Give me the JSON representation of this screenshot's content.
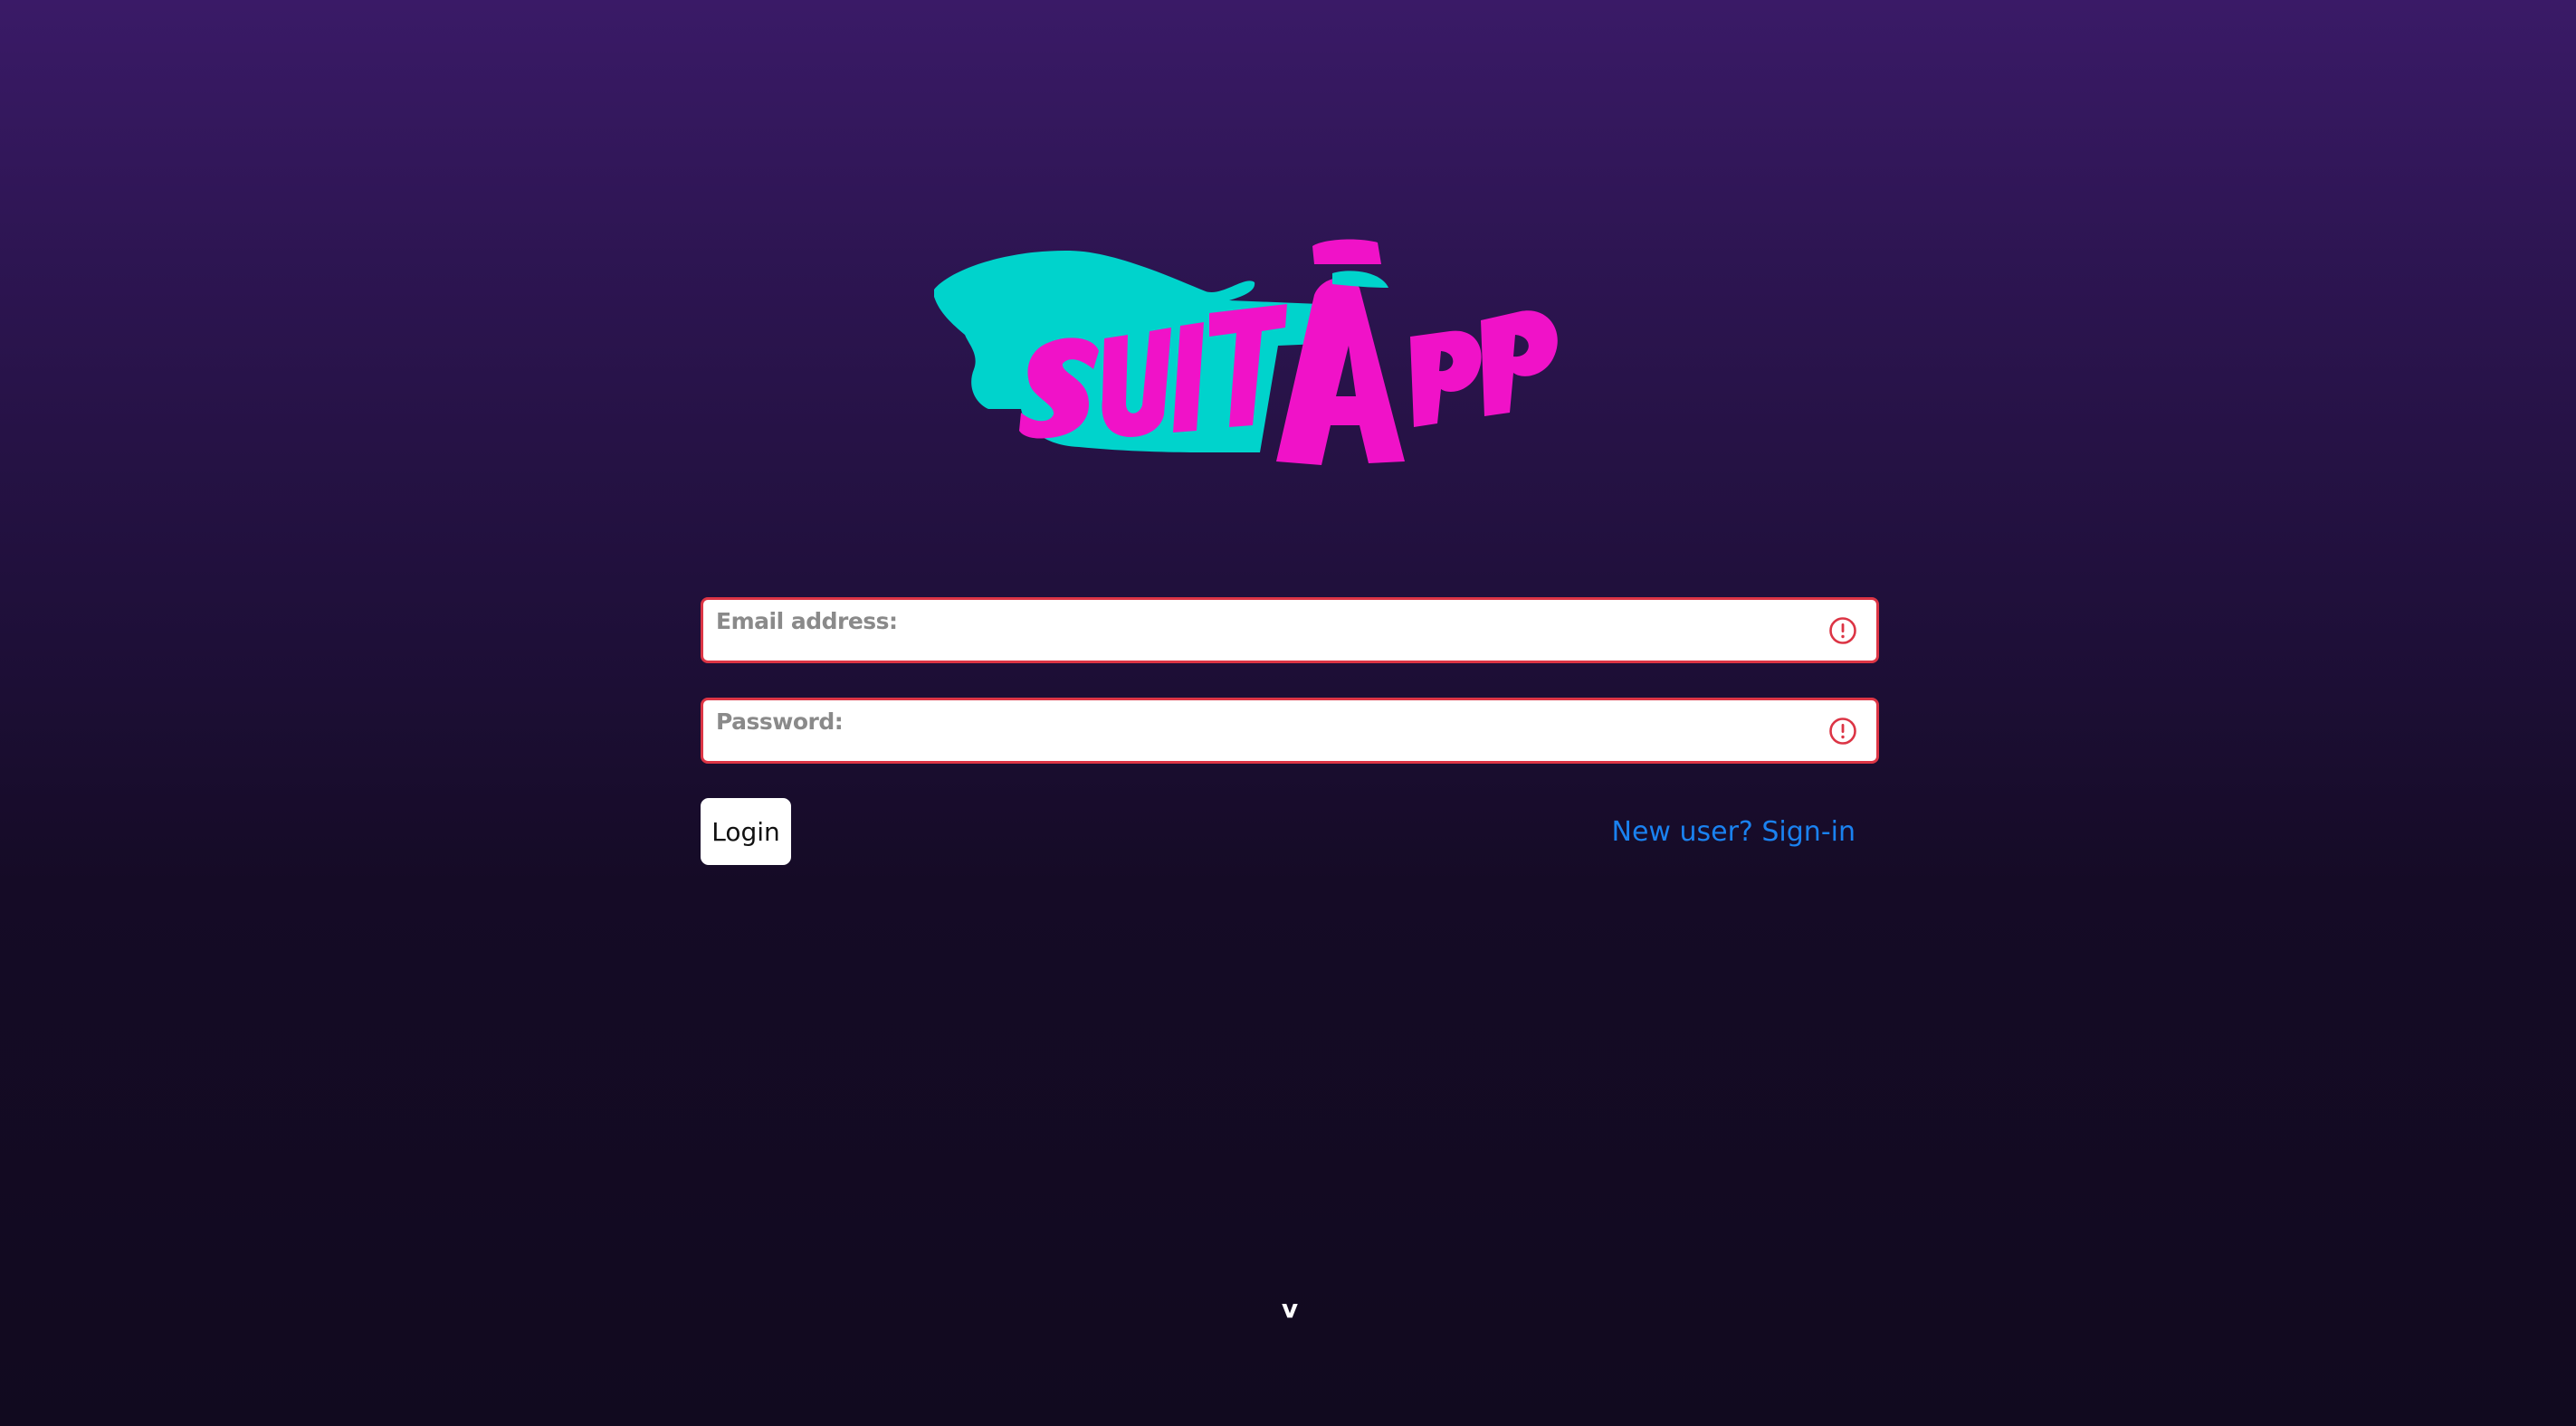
{
  "logo": {
    "text": "SuitApp",
    "colors": {
      "cape": "#00d3cc",
      "letters": "#f012c8"
    }
  },
  "form": {
    "email": {
      "label": "Email address:",
      "value": "",
      "status_icon": "alert-circle-icon"
    },
    "password": {
      "label": "Password:",
      "value": "",
      "status_icon": "alert-circle-icon"
    }
  },
  "actions": {
    "login_label": "Login",
    "signup_label": "New user? Sign-in"
  },
  "footer": {
    "version_label": "v"
  },
  "colors": {
    "background_top": "#3a1a67",
    "background_bottom": "#110a1f",
    "error_border": "#dc3545",
    "link": "#1a82f0"
  }
}
